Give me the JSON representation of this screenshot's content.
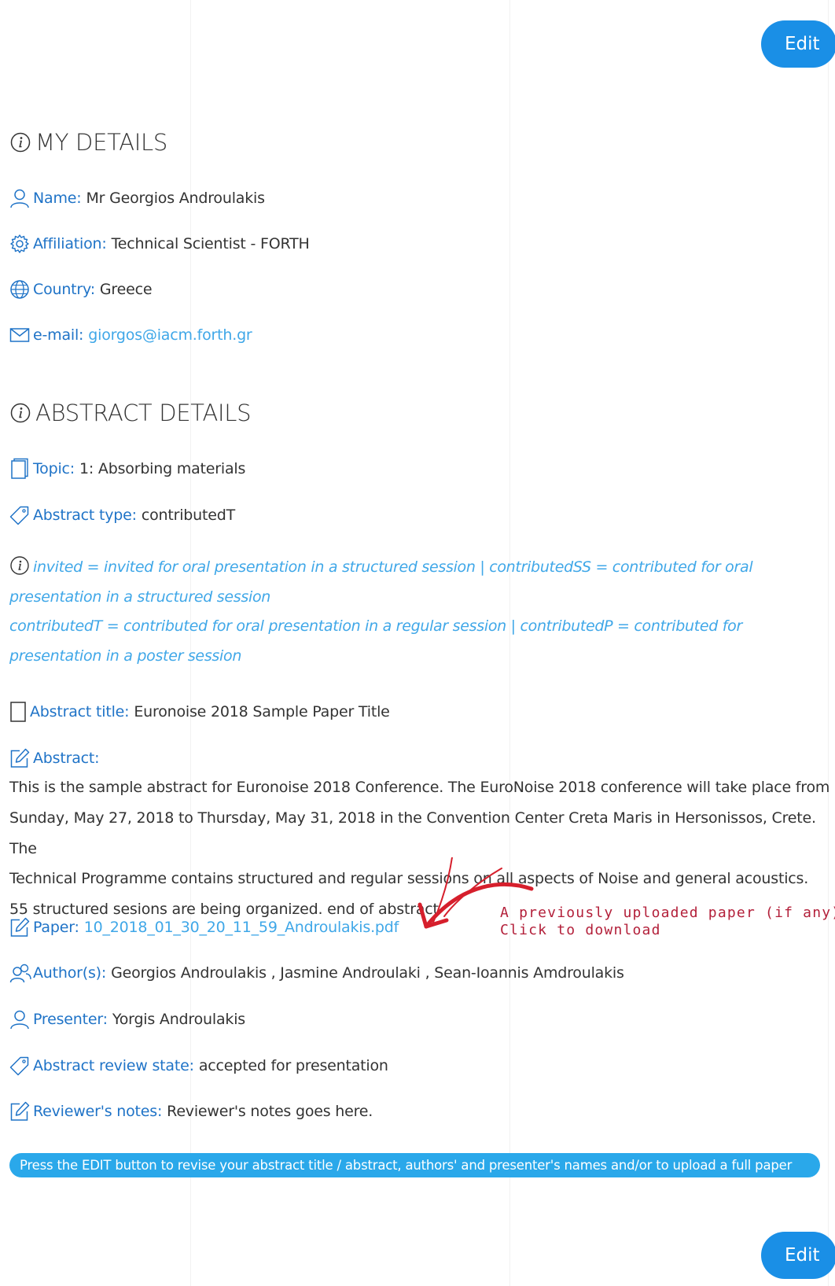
{
  "edit_label": "Edit",
  "my_details": {
    "title": "MY DETAILS",
    "name": {
      "label": "Name:",
      "value": "Mr Georgios Androulakis"
    },
    "affiliation": {
      "label": "Affiliation:",
      "value": "Technical Scientist - FORTH"
    },
    "country": {
      "label": "Country:",
      "value": "Greece"
    },
    "email": {
      "label": "e-mail:",
      "value": "giorgos@iacm.forth.gr"
    }
  },
  "abstract_details": {
    "title": "ABSTRACT DETAILS",
    "topic": {
      "label": "Topic:",
      "value": "1: Absorbing materials"
    },
    "abstract_type": {
      "label": "Abstract type:",
      "value": "contributedT"
    },
    "type_note": "invited = invited for oral presentation in a structured session | contributedSS = contributed for oral presentation in a structured session\ncontributedT = contributed for oral presentation in a regular session | contributedP = contributed for presentation in a poster session",
    "abstract_title": {
      "label": "Abstract title:",
      "value": "Euronoise 2018 Sample Paper Title"
    },
    "abstract": {
      "label": "Abstract:",
      "value": "This is the sample abstract for Euronoise 2018 Conference. The EuroNoise 2018 conference will take place from\nSunday, May 27, 2018 to Thursday, May 31, 2018 in the Convention Center Creta Maris in Hersonissos, Crete. The\nTechnical Programme contains structured and regular sessions on all aspects of Noise and general acoustics.\n55 structured sesions are being organized. end of abstract"
    },
    "paper": {
      "label": "Paper:",
      "value": "10_2018_01_30_20_11_59_Androulakis.pdf"
    },
    "authors": {
      "label": "Author(s):",
      "value": "Georgios Androulakis , Jasmine Androulaki , Sean-Ioannis Amdroulakis"
    },
    "presenter": {
      "label": "Presenter:",
      "value": "Yorgis Androulakis"
    },
    "review_state": {
      "label": "Abstract review state:",
      "value": "accepted for presentation"
    },
    "reviewer_notes": {
      "label": "Reviewer's notes:",
      "value": "Reviewer's notes goes here."
    }
  },
  "annotation": "A previously uploaded paper (if any).\nClick to download",
  "info_bar": "Press the EDIT button to revise your abstract title / abstract, authors' and presenter's names and/or to upload a full paper",
  "colors": {
    "accent": "#1a8fe6",
    "label": "#1f73c7",
    "link": "#3fa7e8",
    "annotation": "#b3203a"
  }
}
